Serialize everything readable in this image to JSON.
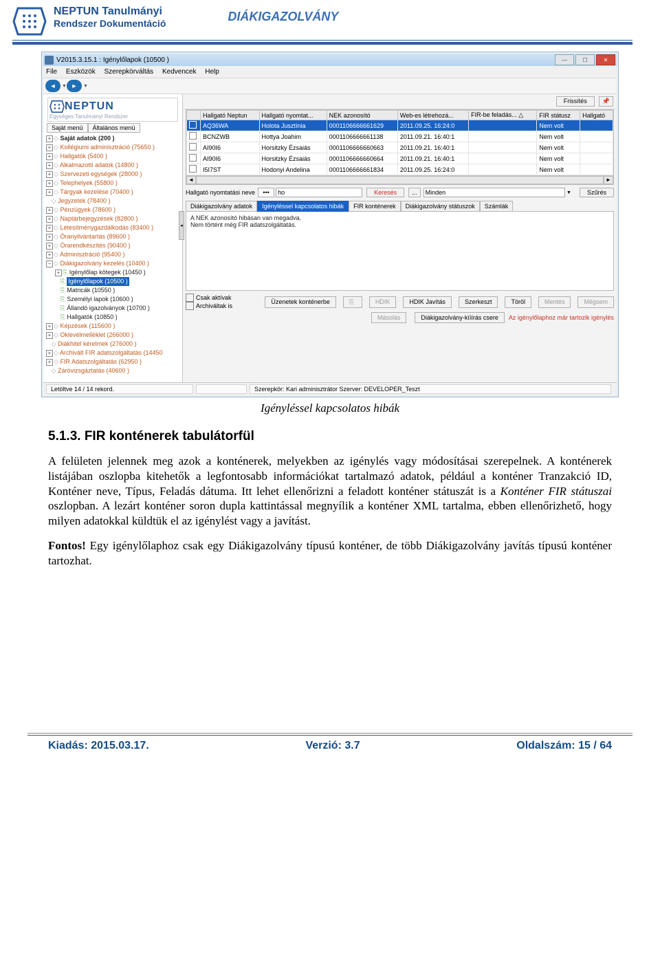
{
  "header": {
    "line1": "NEPTUN Tanulmányi",
    "line2": "Rendszer Dokumentáció",
    "right": "DIÁKIGAZOLVÁNY"
  },
  "window": {
    "title": "V2015.3.15.1 : Igénylőlapok (10500 )",
    "menus": [
      "File",
      "Eszközök",
      "Szerepkörváltás",
      "Kedvencek",
      "Help"
    ],
    "refresh_btn": "Frissítés",
    "pin_btn": "📌"
  },
  "sidebar": {
    "brand": "NEPTUN",
    "brand_tag": "Egységes Tanulmányi Rendszer",
    "tab1": "Saját menü",
    "tab2": "Általános menü",
    "nodes": [
      "Saját adatok (200 )",
      "Kollégiumi adminisztráció (75650 )",
      "Hallgatók (5400 )",
      "Alkalmazotti adatok (14800 )",
      "Szervezeti egységek (28000 )",
      "Telephelyek (55800 )",
      "Tárgyak kezelése (70400 )",
      "Jegyzetek (78400 )",
      "Pénzügyek (78600 )",
      "Naptárbejegyzések (82800 )",
      "Létesítménygazdálkodás (83400 )",
      "Óranyilvántartás (89600 )",
      "Órarendkészítés (90400 )",
      "Adminisztráció (95400 )",
      "Diákigazolvány kezelés (10400 )",
      "Képzések (115600 )",
      "Oklevélmelléklet (266000 )",
      "Diákhitel kérelmek (276000 )",
      "Archivált FIR adatszolgáltatás (14450",
      "FIR Adatszolgáltatás (62950 )",
      "Záróvizsgáztatás (40600 )"
    ],
    "subnodes": [
      "Igénylőlap kötegek (10450 )",
      "Igénylőlapok (10500 )",
      "Matricák (10550 )",
      "Személyi lapok (10600 )",
      "Állandó igazolványok (10700 )",
      "Hallgatók (10850 )"
    ]
  },
  "grid": {
    "headers": [
      "",
      "Hallgató Neptun",
      "Hallgató nyomtat...",
      "NEK azonosító",
      "Web-es létrehozá...",
      "FIR-be feladás... △",
      "FIR státusz",
      "Hallgató"
    ],
    "rows": [
      [
        "AQ36WA",
        "Holota Jusztínia",
        "0001106666661629",
        "2011.09.25. 16:24:0",
        "",
        "Nem volt"
      ],
      [
        "BCNZWB",
        "Hottya Joahim",
        "0001106666661138",
        "2011.09.21. 16:40:1",
        "",
        "Nem volt"
      ],
      [
        "AI90I6",
        "Horsitzky Ézsaiás",
        "0001106666660663",
        "2011.09.21. 16:40:1",
        "",
        "Nem volt"
      ],
      [
        "AI90I6",
        "Horsitzky Ézsaiás",
        "0001106666660664",
        "2011.09.21. 16:40:1",
        "",
        "Nem volt"
      ],
      [
        "I5I7ST",
        "Hodonyi Andelina",
        "0001106666661834",
        "2011.09.25. 16:24:0",
        "",
        "Nem volt"
      ]
    ]
  },
  "search": {
    "label": "Hallgató nyomtatási neve",
    "mode": "•••",
    "value": "ho",
    "search_btn": "Keresés",
    "dots_btn": "...",
    "filter_value": "Minden",
    "filter_btn": "Szűrés"
  },
  "tabs": {
    "t1": "Diákigazolvány adatok",
    "t2": "Igényléssel kapcsolatos hibák",
    "t3": "FIR konténerek",
    "t4": "Diákigazolvány státuszok",
    "t5": "Számlák"
  },
  "messages": {
    "m1": "A NEK azonosító hibásan van megadva.",
    "m2": "Nem történt még FIR adatszolgáltatás."
  },
  "bottom": {
    "only_active": "Csak aktívak",
    "archived": "Archiváltak is",
    "b1": "Üzenetek konténerbe",
    "b2": "HDIK",
    "b3": "HDIK Javítás",
    "b4": "Szerkeszt",
    "b5": "Töröl",
    "b6": "Mentés",
    "b7": "Mégsem",
    "b8": "Másolás",
    "b9": "Diákigazolvány-kííírás csere",
    "warn": "Az igénylőlaphoz már tartozik igénylés"
  },
  "statusbar": {
    "left": "Letöltve 14 / 14 rekord.",
    "mid": "Szerepkör: Kari adminisztrátor  Szerver: DEVELOPER_Teszt"
  },
  "caption": "Igényléssel kapcsolatos hibák",
  "content": {
    "heading": "5.1.3. FIR konténerek tabulátorfül",
    "p1a": "A felületen jelennek meg azok a konténerek, melyekben az igénylés vagy módosításai szerepelnek. A konténerek listájában oszlopba kitehetők a legfontosabb információkat tartalmazó adatok, például a konténer Tranzakció ID, Konténer neve, Típus, Feladás dátuma. Itt lehet ellenőrizni a feladott konténer státuszát is a ",
    "p1b": "Konténer FIR státuszai",
    "p1c": " oszlopban. A lezárt konténer soron dupla kattintással megnyílik a konténer XML tartalma, ebben ellenőrizhető, hogy milyen adatokkal küldtük el az igénylést vagy a javítást.",
    "p2a": "Fontos!",
    "p2b": " Egy igénylőlaphoz csak egy Diákigazolvány típusú konténer, de több Diákigazolvány javítás típusú konténer tartozhat."
  },
  "footer": {
    "left": "Kiadás: 2015.03.17.",
    "mid": "Verzió: 3.7",
    "right": "Oldalszám: 15 / 64"
  }
}
